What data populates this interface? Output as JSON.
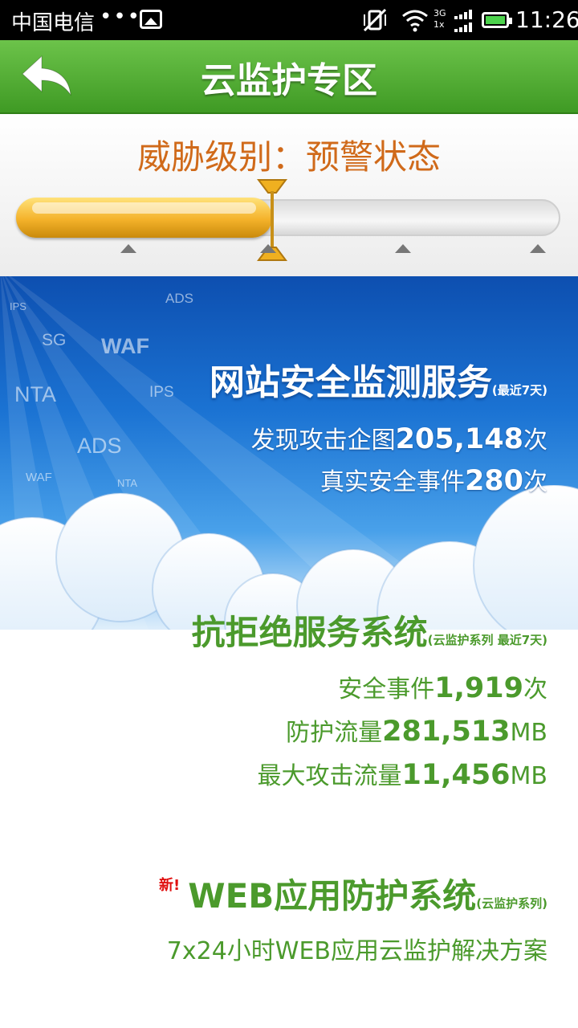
{
  "status_bar": {
    "carrier": "中国电信",
    "dots": "•••",
    "network_top": "3G",
    "network_bottom": "1x",
    "time": "11:26"
  },
  "header": {
    "title": "云监护专区"
  },
  "threat": {
    "label": "威胁级别：预警状态",
    "level_fraction": 0.47,
    "ticks": 4
  },
  "hero_tags": [
    "IPS",
    "ADS",
    "SG",
    "WAF",
    "NTA",
    "IPS",
    "ADS",
    "WAF",
    "NTA"
  ],
  "website_monitor": {
    "title": "网站安全监测服务",
    "period": "(最近7天)",
    "attack_label": "发现攻击企图",
    "attack_value": "205,148",
    "attack_unit": "次",
    "event_label": "真实安全事件",
    "event_value": "280",
    "event_unit": "次"
  },
  "ddos": {
    "title": "抗拒绝服务系统",
    "period": "(云监护系列 最近7天)",
    "event_label": "安全事件",
    "event_value": "1,919",
    "event_unit": "次",
    "traffic_label": "防护流量",
    "traffic_value": "281,513",
    "traffic_unit": "MB",
    "max_label": "最大攻击流量",
    "max_value": "11,456",
    "max_unit": "MB"
  },
  "waf": {
    "new_badge": "新!",
    "title": "WEB应用防护系统",
    "series": "(云监护系列)",
    "desc": "7x24小时WEB应用云监护解决方案"
  },
  "colors": {
    "header_green": "#4aa52c",
    "threat_orange": "#d06a1a",
    "text_green": "#4b9a2c",
    "sky_blue": "#1b73d3",
    "new_red": "#e01010"
  }
}
